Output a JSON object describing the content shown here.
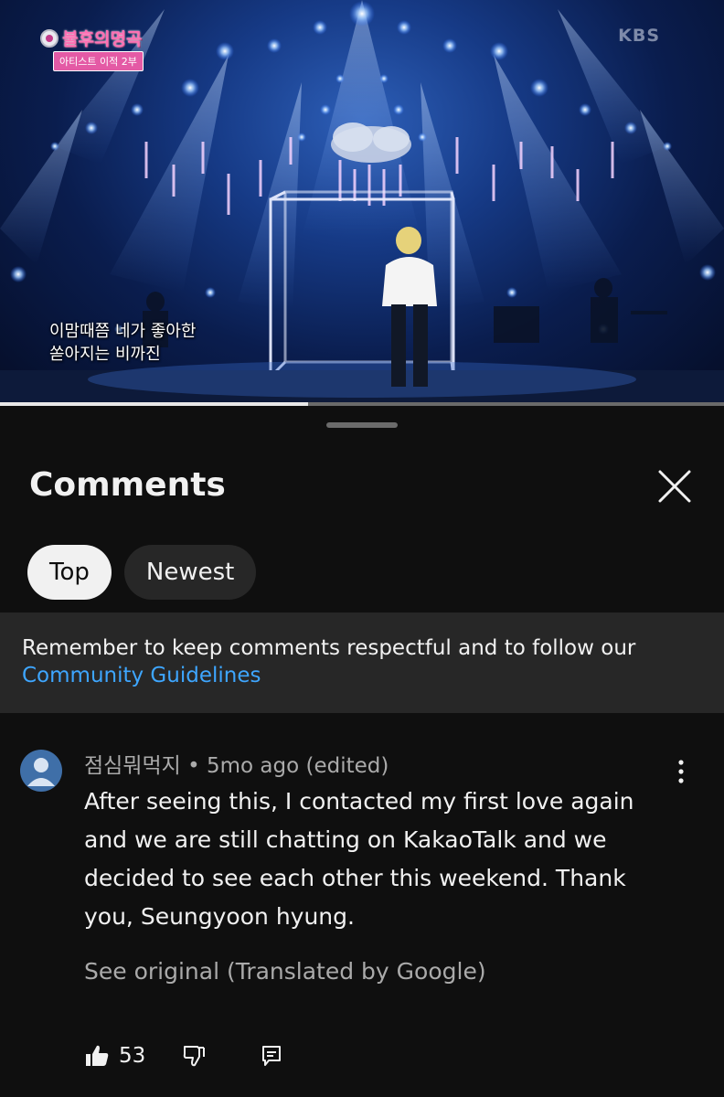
{
  "video": {
    "show_logo": "불후의명곡",
    "show_subtitle": "아티스트 이적 2부",
    "channel_watermark": "KBS",
    "caption_lines": [
      "이맘때쯤 네가 좋아한",
      "쏟아지는 비까진"
    ],
    "progress_fraction": 0.425
  },
  "comments_panel": {
    "title": "Comments",
    "close_icon": "close-icon",
    "sort_chips": [
      {
        "label": "Top",
        "active": true
      },
      {
        "label": "Newest",
        "active": false
      }
    ],
    "notice": {
      "text": "Remember to keep comments respectful and to follow our",
      "link": "Community Guidelines"
    }
  },
  "comment": {
    "author": "점심뭐먹지",
    "separator": "•",
    "time": "5mo ago (edited)",
    "text": "After seeing this, I contacted my first love again and we are still chatting on KakaoTalk and we decided to see each other this weekend. Thank you, Seungyoon hyung.",
    "see_original": "See original (Translated by Google)",
    "like_count": "53",
    "icons": [
      "thumbs-up-icon",
      "thumbs-down-icon",
      "reply-icon",
      "more-vert-icon",
      "avatar-icon"
    ]
  },
  "colors": {
    "background": "#0f0f0f",
    "surface": "#272727",
    "link": "#3ea6ff",
    "secondary_text": "#aaaaaa",
    "avatar": "#3f6fa8"
  }
}
